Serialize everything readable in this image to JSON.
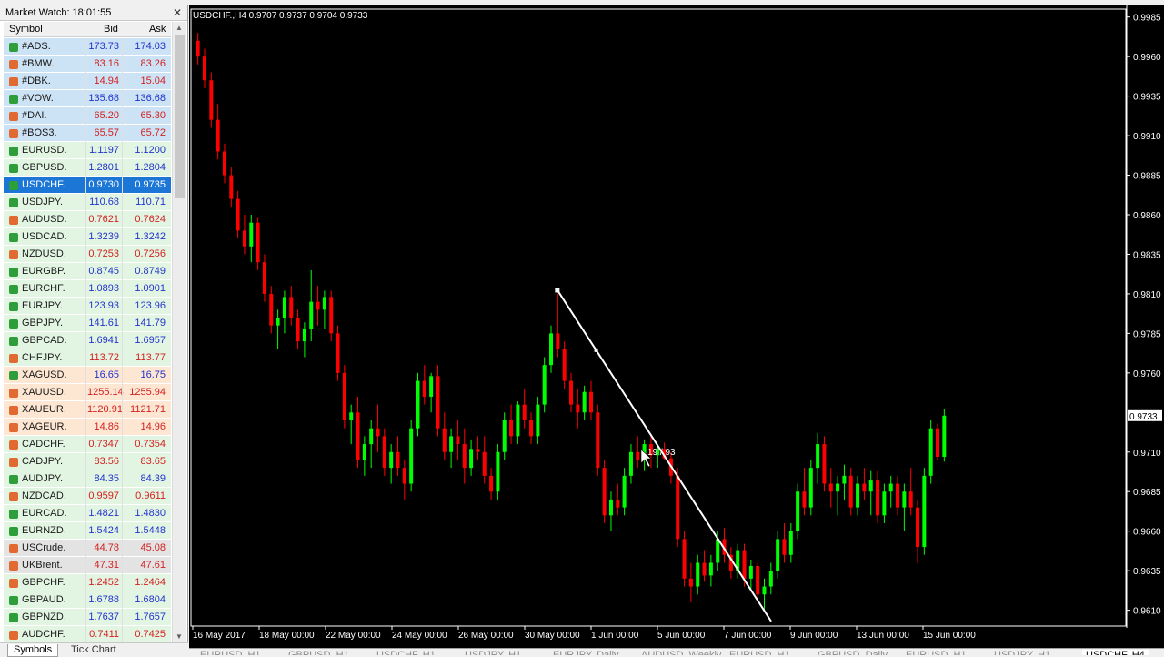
{
  "market_watch": {
    "title": "Market Watch: 18:01:55",
    "columns": {
      "symbol": "Symbol",
      "bid": "Bid",
      "ask": "Ask"
    },
    "rows": [
      {
        "symbol": "#ADS.",
        "bid": "173.73",
        "ask": "174.03",
        "dir": "up",
        "bid_color": "blue",
        "ask_color": "blue",
        "bg": "#cce2f5"
      },
      {
        "symbol": "#BMW.",
        "bid": "83.16",
        "ask": "83.26",
        "dir": "dn",
        "bid_color": "red",
        "ask_color": "red",
        "bg": "#cce2f5"
      },
      {
        "symbol": "#DBK.",
        "bid": "14.94",
        "ask": "15.04",
        "dir": "dn",
        "bid_color": "red",
        "ask_color": "red",
        "bg": "#cce2f5"
      },
      {
        "symbol": "#VOW.",
        "bid": "135.68",
        "ask": "136.68",
        "dir": "up",
        "bid_color": "blue",
        "ask_color": "blue",
        "bg": "#cce2f5"
      },
      {
        "symbol": "#DAI.",
        "bid": "65.20",
        "ask": "65.30",
        "dir": "dn",
        "bid_color": "red",
        "ask_color": "red",
        "bg": "#cce2f5"
      },
      {
        "symbol": "#BOS3.",
        "bid": "65.57",
        "ask": "65.72",
        "dir": "dn",
        "bid_color": "red",
        "ask_color": "red",
        "bg": "#cce2f5"
      },
      {
        "symbol": "EURUSD.",
        "bid": "1.1197",
        "ask": "1.1200",
        "dir": "up",
        "bid_color": "blue",
        "ask_color": "blue",
        "bg": "#e2f5e2"
      },
      {
        "symbol": "GBPUSD.",
        "bid": "1.2801",
        "ask": "1.2804",
        "dir": "up",
        "bid_color": "blue",
        "ask_color": "blue",
        "bg": "#e2f5e2"
      },
      {
        "symbol": "USDCHF.",
        "bid": "0.9730",
        "ask": "0.9735",
        "dir": "up",
        "bid_color": "blue",
        "ask_color": "blue",
        "bg": "#e2f5e2",
        "selected": true
      },
      {
        "symbol": "USDJPY.",
        "bid": "110.68",
        "ask": "110.71",
        "dir": "up",
        "bid_color": "blue",
        "ask_color": "blue",
        "bg": "#e2f5e2"
      },
      {
        "symbol": "AUDUSD.",
        "bid": "0.7621",
        "ask": "0.7624",
        "dir": "dn",
        "bid_color": "red",
        "ask_color": "red",
        "bg": "#e2f5e2"
      },
      {
        "symbol": "USDCAD.",
        "bid": "1.3239",
        "ask": "1.3242",
        "dir": "up",
        "bid_color": "blue",
        "ask_color": "blue",
        "bg": "#e2f5e2"
      },
      {
        "symbol": "NZDUSD.",
        "bid": "0.7253",
        "ask": "0.7256",
        "dir": "dn",
        "bid_color": "red",
        "ask_color": "red",
        "bg": "#e2f5e2"
      },
      {
        "symbol": "EURGBP.",
        "bid": "0.8745",
        "ask": "0.8749",
        "dir": "up",
        "bid_color": "blue",
        "ask_color": "blue",
        "bg": "#e2f5e2"
      },
      {
        "symbol": "EURCHF.",
        "bid": "1.0893",
        "ask": "1.0901",
        "dir": "up",
        "bid_color": "blue",
        "ask_color": "blue",
        "bg": "#e2f5e2"
      },
      {
        "symbol": "EURJPY.",
        "bid": "123.93",
        "ask": "123.96",
        "dir": "up",
        "bid_color": "blue",
        "ask_color": "blue",
        "bg": "#e2f5e2"
      },
      {
        "symbol": "GBPJPY.",
        "bid": "141.61",
        "ask": "141.79",
        "dir": "up",
        "bid_color": "blue",
        "ask_color": "blue",
        "bg": "#e2f5e2"
      },
      {
        "symbol": "GBPCAD.",
        "bid": "1.6941",
        "ask": "1.6957",
        "dir": "up",
        "bid_color": "blue",
        "ask_color": "blue",
        "bg": "#e2f5e2"
      },
      {
        "symbol": "CHFJPY.",
        "bid": "113.72",
        "ask": "113.77",
        "dir": "dn",
        "bid_color": "red",
        "ask_color": "red",
        "bg": "#e2f5e2"
      },
      {
        "symbol": "XAGUSD.",
        "bid": "16.65",
        "ask": "16.75",
        "dir": "up",
        "bid_color": "blue",
        "ask_color": "blue",
        "bg": "#fde6d2"
      },
      {
        "symbol": "XAUUSD.",
        "bid": "1255.14",
        "ask": "1255.94",
        "dir": "dn",
        "bid_color": "red",
        "ask_color": "red",
        "bg": "#fde6d2"
      },
      {
        "symbol": "XAUEUR.",
        "bid": "1120.91",
        "ask": "1121.71",
        "dir": "dn",
        "bid_color": "red",
        "ask_color": "red",
        "bg": "#fde6d2"
      },
      {
        "symbol": "XAGEUR.",
        "bid": "14.86",
        "ask": "14.96",
        "dir": "dn",
        "bid_color": "red",
        "ask_color": "red",
        "bg": "#fde6d2"
      },
      {
        "symbol": "CADCHF.",
        "bid": "0.7347",
        "ask": "0.7354",
        "dir": "dn",
        "bid_color": "red",
        "ask_color": "red",
        "bg": "#e2f5e2"
      },
      {
        "symbol": "CADJPY.",
        "bid": "83.56",
        "ask": "83.65",
        "dir": "dn",
        "bid_color": "red",
        "ask_color": "red",
        "bg": "#e2f5e2"
      },
      {
        "symbol": "AUDJPY.",
        "bid": "84.35",
        "ask": "84.39",
        "dir": "up",
        "bid_color": "blue",
        "ask_color": "blue",
        "bg": "#e2f5e2"
      },
      {
        "symbol": "NZDCAD.",
        "bid": "0.9597",
        "ask": "0.9611",
        "dir": "dn",
        "bid_color": "red",
        "ask_color": "red",
        "bg": "#e2f5e2"
      },
      {
        "symbol": "EURCAD.",
        "bid": "1.4821",
        "ask": "1.4830",
        "dir": "up",
        "bid_color": "blue",
        "ask_color": "blue",
        "bg": "#e2f5e2"
      },
      {
        "symbol": "EURNZD.",
        "bid": "1.5424",
        "ask": "1.5448",
        "dir": "up",
        "bid_color": "blue",
        "ask_color": "blue",
        "bg": "#e2f5e2"
      },
      {
        "symbol": "USCrude.",
        "bid": "44.78",
        "ask": "45.08",
        "dir": "dn",
        "bid_color": "red",
        "ask_color": "red",
        "bg": "#e3e3e3"
      },
      {
        "symbol": "UKBrent.",
        "bid": "47.31",
        "ask": "47.61",
        "dir": "dn",
        "bid_color": "red",
        "ask_color": "red",
        "bg": "#e3e3e3"
      },
      {
        "symbol": "GBPCHF.",
        "bid": "1.2452",
        "ask": "1.2464",
        "dir": "dn",
        "bid_color": "red",
        "ask_color": "red",
        "bg": "#e2f5e2"
      },
      {
        "symbol": "GBPAUD.",
        "bid": "1.6788",
        "ask": "1.6804",
        "dir": "up",
        "bid_color": "blue",
        "ask_color": "blue",
        "bg": "#e2f5e2"
      },
      {
        "symbol": "GBPNZD.",
        "bid": "1.7637",
        "ask": "1.7657",
        "dir": "up",
        "bid_color": "blue",
        "ask_color": "blue",
        "bg": "#e2f5e2"
      },
      {
        "symbol": "AUDCHF.",
        "bid": "0.7411",
        "ask": "0.7425",
        "dir": "dn",
        "bid_color": "red",
        "ask_color": "red",
        "bg": "#e2f5e2"
      }
    ],
    "tabs": [
      "Symbols",
      "Tick Chart"
    ]
  },
  "colors": {
    "blue": "#2233cc",
    "red": "#d42020",
    "bull": "#00ff00",
    "bear": "#ff0000",
    "bg": "#000000",
    "trendline": "#ffffff"
  },
  "chart_data": {
    "type": "candlestick",
    "title": "USDCHF.,H4  0.9707 0.9737 0.9704 0.9733",
    "current_price_label": "0.9733",
    "y_ticks": [
      "0.9985",
      "0.9960",
      "0.9935",
      "0.9910",
      "0.9885",
      "0.9860",
      "0.9835",
      "0.9810",
      "0.9785",
      "0.9760",
      "0.9733",
      "0.9710",
      "0.9685",
      "0.9660",
      "0.9635",
      "0.9610"
    ],
    "ylim": [
      0.96,
      0.999
    ],
    "x_ticks": [
      "16 May 2017",
      "18 May 00:00",
      "22 May 00:00",
      "24 May 00:00",
      "26 May 00:00",
      "30 May 00:00",
      "1 Jun 00:00",
      "5 Jun 00:00",
      "7 Jun 00:00",
      "9 Jun 00:00",
      "13 Jun 00:00",
      "15 Jun 00:00"
    ],
    "trendline": {
      "from": [
        0.9812
      ],
      "to": [
        0.9603
      ],
      "label": "19 / 93"
    },
    "bars": [
      [
        0.997,
        0.9975,
        0.9955,
        0.996
      ],
      [
        0.996,
        0.9965,
        0.994,
        0.9945
      ],
      [
        0.9945,
        0.995,
        0.9915,
        0.992
      ],
      [
        0.992,
        0.993,
        0.9895,
        0.99
      ],
      [
        0.99,
        0.9905,
        0.988,
        0.9885
      ],
      [
        0.9885,
        0.989,
        0.9865,
        0.987
      ],
      [
        0.987,
        0.9875,
        0.9845,
        0.985
      ],
      [
        0.985,
        0.986,
        0.9835,
        0.984
      ],
      [
        0.984,
        0.986,
        0.983,
        0.9855
      ],
      [
        0.9855,
        0.9858,
        0.9825,
        0.983
      ],
      [
        0.983,
        0.9835,
        0.9805,
        0.981
      ],
      [
        0.981,
        0.9815,
        0.9785,
        0.979
      ],
      [
        0.979,
        0.98,
        0.9775,
        0.9795
      ],
      [
        0.9795,
        0.9812,
        0.9785,
        0.9808
      ],
      [
        0.9808,
        0.9815,
        0.979,
        0.9795
      ],
      [
        0.9795,
        0.98,
        0.9775,
        0.978
      ],
      [
        0.978,
        0.9792,
        0.977,
        0.9788
      ],
      [
        0.9788,
        0.9825,
        0.978,
        0.9805
      ],
      [
        0.9805,
        0.9815,
        0.979,
        0.98
      ],
      [
        0.98,
        0.9812,
        0.9788,
        0.9808
      ],
      [
        0.9808,
        0.9812,
        0.978,
        0.9785
      ],
      [
        0.9785,
        0.979,
        0.9755,
        0.976
      ],
      [
        0.976,
        0.9765,
        0.9725,
        0.973
      ],
      [
        0.973,
        0.974,
        0.9715,
        0.9735
      ],
      [
        0.9735,
        0.9745,
        0.97,
        0.9705
      ],
      [
        0.9705,
        0.972,
        0.9695,
        0.9715
      ],
      [
        0.9715,
        0.973,
        0.97,
        0.9725
      ],
      [
        0.9725,
        0.974,
        0.971,
        0.972
      ],
      [
        0.972,
        0.9725,
        0.9695,
        0.97
      ],
      [
        0.97,
        0.9715,
        0.969,
        0.971
      ],
      [
        0.971,
        0.972,
        0.9695,
        0.97
      ],
      [
        0.97,
        0.9705,
        0.968,
        0.969
      ],
      [
        0.969,
        0.973,
        0.9685,
        0.9725
      ],
      [
        0.9725,
        0.976,
        0.972,
        0.9755
      ],
      [
        0.9755,
        0.9765,
        0.974,
        0.9745
      ],
      [
        0.9745,
        0.976,
        0.9735,
        0.9758
      ],
      [
        0.9758,
        0.9765,
        0.972,
        0.9725
      ],
      [
        0.9725,
        0.9735,
        0.9705,
        0.971
      ],
      [
        0.971,
        0.9725,
        0.97,
        0.972
      ],
      [
        0.972,
        0.973,
        0.9705,
        0.9715
      ],
      [
        0.9715,
        0.9725,
        0.969,
        0.97
      ],
      [
        0.97,
        0.9718,
        0.9695,
        0.9712
      ],
      [
        0.9712,
        0.972,
        0.9705,
        0.971
      ],
      [
        0.971,
        0.972,
        0.969,
        0.9695
      ],
      [
        0.9695,
        0.97,
        0.968,
        0.9685
      ],
      [
        0.9685,
        0.9715,
        0.968,
        0.971
      ],
      [
        0.971,
        0.9735,
        0.9705,
        0.973
      ],
      [
        0.973,
        0.974,
        0.9715,
        0.972
      ],
      [
        0.972,
        0.9742,
        0.9715,
        0.974
      ],
      [
        0.974,
        0.975,
        0.9725,
        0.973
      ],
      [
        0.973,
        0.9735,
        0.9715,
        0.972
      ],
      [
        0.972,
        0.9745,
        0.9715,
        0.974
      ],
      [
        0.974,
        0.977,
        0.9735,
        0.9765
      ],
      [
        0.9765,
        0.979,
        0.976,
        0.9785
      ],
      [
        0.9785,
        0.981,
        0.977,
        0.9775
      ],
      [
        0.9775,
        0.978,
        0.975,
        0.9755
      ],
      [
        0.9755,
        0.976,
        0.9735,
        0.974
      ],
      [
        0.974,
        0.975,
        0.9725,
        0.9735
      ],
      [
        0.9735,
        0.9752,
        0.973,
        0.9748
      ],
      [
        0.9748,
        0.9755,
        0.973,
        0.9735
      ],
      [
        0.9735,
        0.974,
        0.9695,
        0.97
      ],
      [
        0.97,
        0.9705,
        0.9665,
        0.967
      ],
      [
        0.967,
        0.9685,
        0.966,
        0.968
      ],
      [
        0.968,
        0.969,
        0.967,
        0.9675
      ],
      [
        0.9675,
        0.97,
        0.967,
        0.9695
      ],
      [
        0.9695,
        0.9715,
        0.969,
        0.971
      ],
      [
        0.971,
        0.972,
        0.97,
        0.9705
      ],
      [
        0.9705,
        0.9718,
        0.9698,
        0.9715
      ],
      [
        0.9715,
        0.972,
        0.97,
        0.9708
      ],
      [
        0.9708,
        0.9715,
        0.97,
        0.9712
      ],
      [
        0.9712,
        0.9716,
        0.9705,
        0.9706
      ],
      [
        0.9706,
        0.971,
        0.969,
        0.9695
      ],
      [
        0.9695,
        0.97,
        0.965,
        0.9655
      ],
      [
        0.9655,
        0.966,
        0.9625,
        0.963
      ],
      [
        0.963,
        0.964,
        0.9615,
        0.9625
      ],
      [
        0.9625,
        0.9645,
        0.962,
        0.964
      ],
      [
        0.964,
        0.9648,
        0.9628,
        0.9632
      ],
      [
        0.9632,
        0.9645,
        0.9625,
        0.964
      ],
      [
        0.964,
        0.966,
        0.9635,
        0.9655
      ],
      [
        0.9655,
        0.9662,
        0.964,
        0.9645
      ],
      [
        0.9645,
        0.965,
        0.963,
        0.9635
      ],
      [
        0.9635,
        0.9652,
        0.963,
        0.9648
      ],
      [
        0.9648,
        0.9652,
        0.9625,
        0.963
      ],
      [
        0.963,
        0.9642,
        0.9622,
        0.9638
      ],
      [
        0.9638,
        0.964,
        0.9615,
        0.962
      ],
      [
        0.962,
        0.963,
        0.961,
        0.9625
      ],
      [
        0.9625,
        0.964,
        0.962,
        0.9635
      ],
      [
        0.9635,
        0.966,
        0.963,
        0.9655
      ],
      [
        0.9655,
        0.9665,
        0.964,
        0.9645
      ],
      [
        0.9645,
        0.9665,
        0.964,
        0.966
      ],
      [
        0.966,
        0.969,
        0.9655,
        0.9685
      ],
      [
        0.9685,
        0.97,
        0.967,
        0.9675
      ],
      [
        0.9675,
        0.9705,
        0.967,
        0.97
      ],
      [
        0.97,
        0.9722,
        0.969,
        0.9715
      ],
      [
        0.9715,
        0.972,
        0.9685,
        0.969
      ],
      [
        0.969,
        0.97,
        0.9675,
        0.9685
      ],
      [
        0.9685,
        0.9695,
        0.967,
        0.969
      ],
      [
        0.969,
        0.9702,
        0.968,
        0.9695
      ],
      [
        0.9695,
        0.97,
        0.967,
        0.9675
      ],
      [
        0.9675,
        0.9695,
        0.967,
        0.969
      ],
      [
        0.969,
        0.97,
        0.968,
        0.9685
      ],
      [
        0.9685,
        0.9698,
        0.967,
        0.9692
      ],
      [
        0.9692,
        0.9698,
        0.9665,
        0.967
      ],
      [
        0.967,
        0.969,
        0.9665,
        0.9685
      ],
      [
        0.9685,
        0.9695,
        0.9675,
        0.969
      ],
      [
        0.969,
        0.9695,
        0.967,
        0.9675
      ],
      [
        0.9675,
        0.969,
        0.966,
        0.9685
      ],
      [
        0.9685,
        0.97,
        0.967,
        0.9675
      ],
      [
        0.9675,
        0.968,
        0.964,
        0.965
      ],
      [
        0.965,
        0.97,
        0.9645,
        0.9695
      ],
      [
        0.9695,
        0.973,
        0.969,
        0.9725
      ],
      [
        0.9725,
        0.9728,
        0.9705,
        0.9707
      ],
      [
        0.9707,
        0.9737,
        0.9704,
        0.9733
      ]
    ]
  },
  "chart_tabs": [
    "EURUSD.,H1",
    "GBPUSD.,H1",
    "USDCHF.,H1",
    "USDJPY.,H1",
    "EURJPY.,Daily",
    "AUDUSD.,Weekly",
    "EURUSD.,H1",
    "GBPUSD.,Daily",
    "EURUSD.,H1",
    "USDJPY.,H1",
    "USDCHF.,H4"
  ]
}
